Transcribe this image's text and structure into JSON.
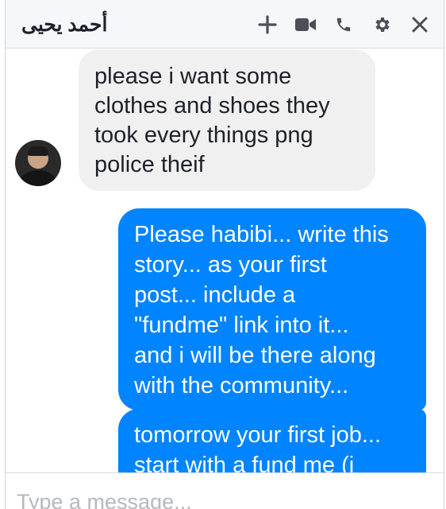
{
  "header": {
    "contact_name": "أحمد يحيى",
    "icons": [
      "add-icon",
      "video-call-icon",
      "phone-icon",
      "gear-icon",
      "close-icon"
    ]
  },
  "messages": [
    {
      "direction": "incoming",
      "lines": [
        "please i want some",
        "clothes and shoes they",
        "took every things png",
        "police theif"
      ]
    },
    {
      "direction": "outgoing",
      "lines": [
        "Please habibi... write this",
        "story... as your first",
        "post... include a",
        "\"fundme\" link into it...",
        "and i will be there along",
        "with the community..."
      ]
    },
    {
      "direction": "outgoing",
      "lines": [
        "tomorrow your first job...",
        "start with a fund me (i"
      ]
    }
  ],
  "composer": {
    "placeholder": "Type a message..."
  },
  "colors": {
    "outgoing_bubble": "#0084ff",
    "incoming_bubble": "#f1f0f0",
    "header_bg": "#f6f7f9"
  }
}
